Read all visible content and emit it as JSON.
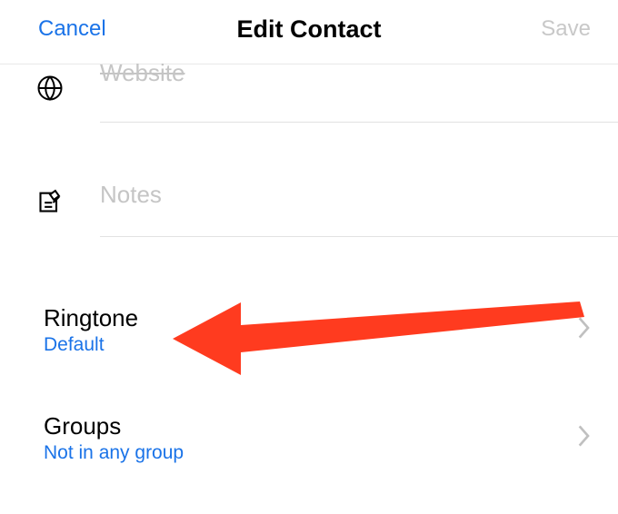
{
  "header": {
    "cancel_label": "Cancel",
    "title": "Edit Contact",
    "save_label": "Save"
  },
  "fields": {
    "website": {
      "placeholder": "Website"
    },
    "notes": {
      "placeholder": "Notes"
    }
  },
  "rows": {
    "ringtone": {
      "title": "Ringtone",
      "value": "Default"
    },
    "groups": {
      "title": "Groups",
      "value": "Not in any group"
    }
  },
  "annotation": {
    "color": "#ff3b1f",
    "target": "ringtone"
  }
}
